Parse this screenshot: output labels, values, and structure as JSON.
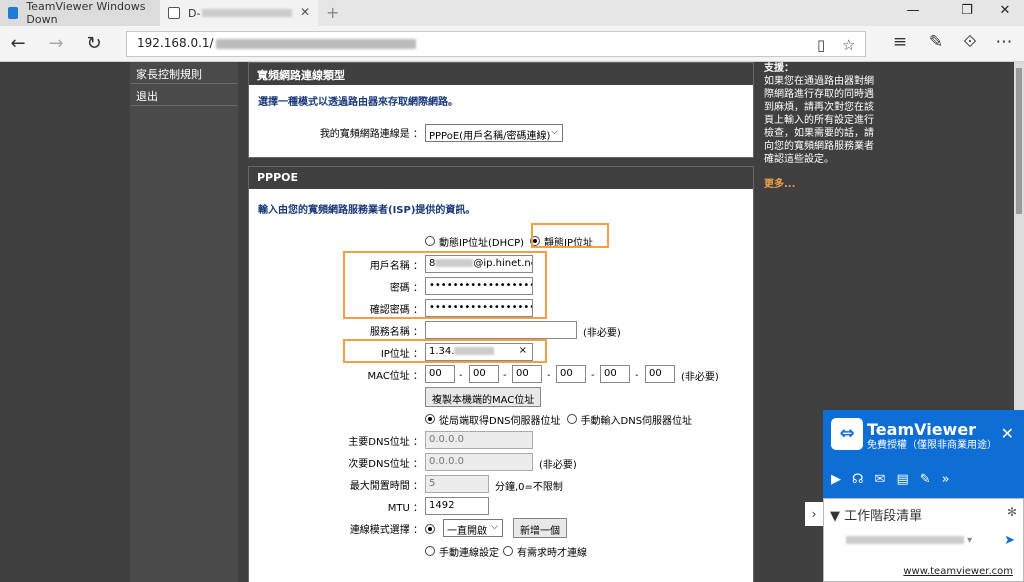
{
  "browser": {
    "tab1_title": "TeamViewer Windows Down",
    "tab2_title": "D-",
    "address": "192.168.0.1/",
    "icons": [
      "back-icon",
      "forward-icon",
      "refresh-icon",
      "reading-view-icon",
      "favorite-star-icon",
      "hub-icon",
      "notes-icon",
      "share-icon",
      "more-icon"
    ]
  },
  "leftnav": {
    "items": [
      "家長控制規則",
      "退出"
    ]
  },
  "conn_type": {
    "title": "寬頻網路連線類型",
    "desc": "選擇一種模式以透過路由器來存取網際網路。",
    "label": "我的寬頻網路連線是 ：",
    "value": "PPPoE(用戶名稱/密碼連線)"
  },
  "pppoe": {
    "title": "PPPOE",
    "desc": "輸入由您的寬頻網路服務業者(ISP)提供的資訊。",
    "radio_dynamic": "動態IP位址(DHCP)",
    "radio_static": "靜態IP位址",
    "username_label": "用戶名稱 ：",
    "username_value": "@ip.hinet.net",
    "username_prefix": "8",
    "password_label": "密碼 ：",
    "password_value": "••••••••••••••••••••",
    "confirm_label": "確認密碼 ：",
    "confirm_value": "••••••••••••••••••••",
    "service_label": "服務名稱 ：",
    "service_value": "",
    "optional": "(非必要)",
    "ip_label": "IP位址 ：",
    "ip_value": "1.34.",
    "ip_clear": "×",
    "mac_label": "MAC位址 ：",
    "mac_values": [
      "00",
      "00",
      "00",
      "00",
      "00",
      "00"
    ],
    "mac_sep": "-",
    "clone_mac_button": "複製本機端的MAC位址",
    "dns_auto": "從局端取得DNS伺服器位址",
    "dns_manual": "手動輸入DNS伺服器位址",
    "dns1_label": "主要DNS位址 ：",
    "dns1_value": "0.0.0.0",
    "dns2_label": "次要DNS位址 ：",
    "dns2_value": "0.0.0.0",
    "idle_label": "最大閒置時間 ：",
    "idle_value": "5",
    "idle_unit": "分鐘,0=不限制",
    "mtu_label": "MTU ：",
    "mtu_value": "1492",
    "mode_label": "連線模式選擇 ：",
    "mode_value": "一直開啟",
    "new_button": "新增一個",
    "mode_manual": "手動連線設定",
    "mode_demand": "有需求時才連線"
  },
  "help": {
    "title": "支援：",
    "text": "如果您在通過路由器對網際網路進行存取的同時遇到麻煩，請再次對您在該頁上輸入的所有設定進行檢查，如果需要的話，請向您的寬頻網路服務業者確認這些設定。",
    "more": "更多..."
  },
  "teamviewer": {
    "name": "TeamViewer",
    "subtitle": "免費授權（僅限非商業用途）",
    "close": "✕",
    "session_list": "▼ 工作階段清單",
    "link": "www.teamviewer.com",
    "accent": "#0e6ed6"
  }
}
